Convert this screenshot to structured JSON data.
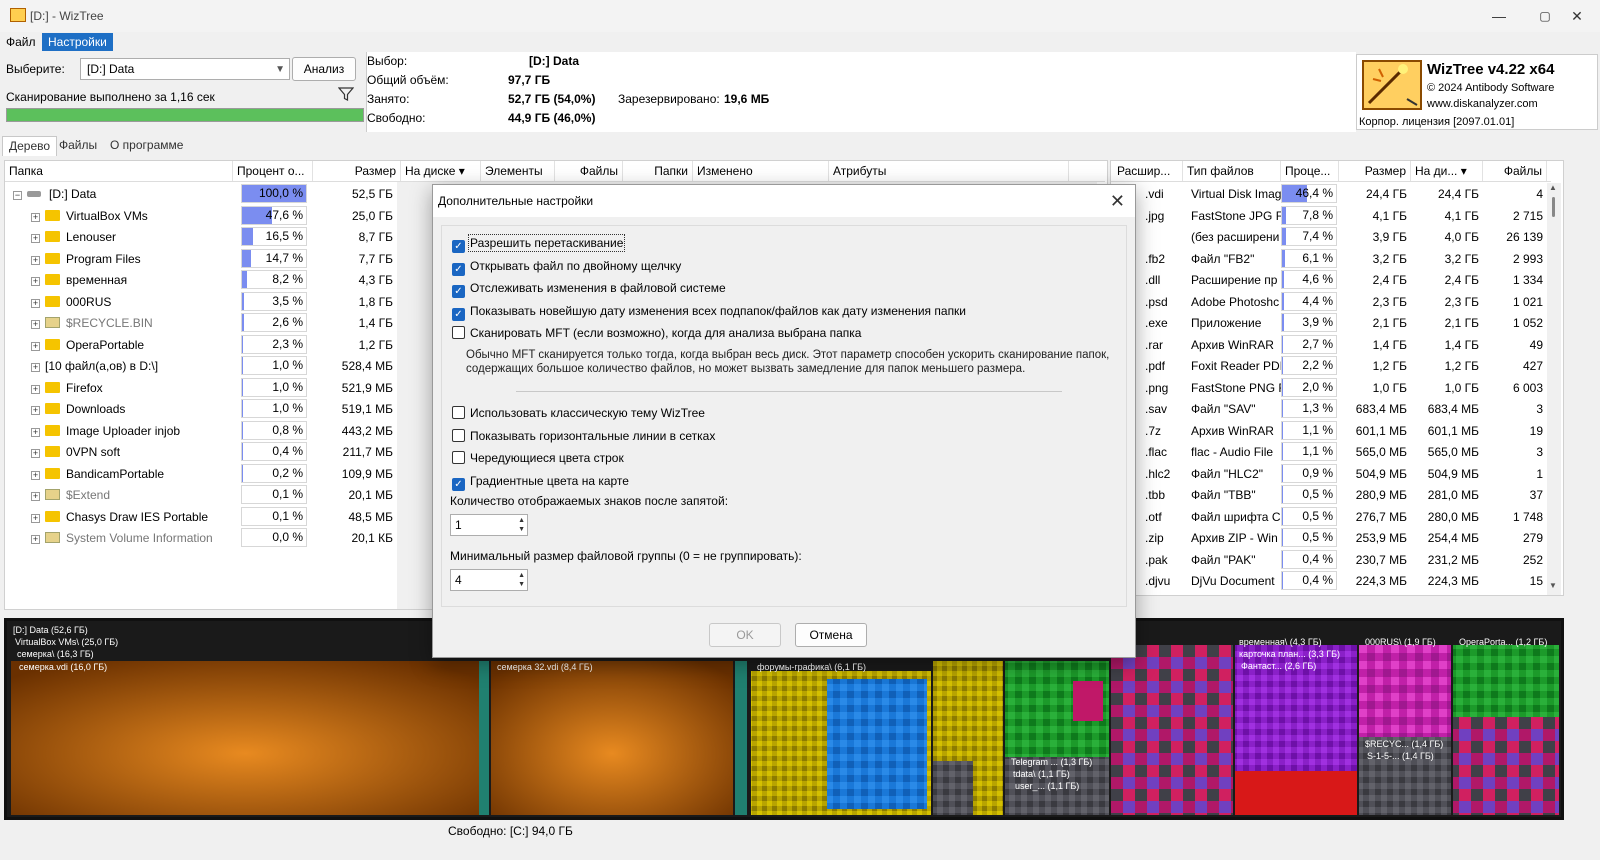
{
  "window": {
    "title": "[D:]  - WizTree",
    "min_label": "—",
    "max_label": "▢",
    "close_label": "✕"
  },
  "menu": {
    "items": [
      {
        "label": "Файл",
        "active": false
      },
      {
        "label": "Настройки",
        "active": true
      }
    ]
  },
  "top": {
    "select_label": "Выберите:",
    "drive": "[D:] Data",
    "analyze": "Анализ",
    "scan_status": "Сканирование выполнено за 1,16 сек",
    "scan_progress": 100,
    "stats": {
      "selection_label": "Выбор:",
      "selection_value": "[D:]  Data",
      "total_label": "Общий объём:",
      "total_value": "97,7 ГБ",
      "used_label": "Занято:",
      "used_value": "52,7 ГБ  (54,0%)",
      "free_label": "Свободно:",
      "free_value": "44,9 ГБ  (46,0%)",
      "reserved_label": "Зарезервировано:",
      "reserved_value": "19,6 МБ"
    },
    "logo": {
      "product": "WizTree v4.22 x64",
      "copyright": "© 2024 Antibody Software",
      "url": "www.diskanalyzer.com",
      "license": "Корпор. лицензия [2097.01.01]"
    }
  },
  "tabs": [
    {
      "label": "Дерево",
      "active": true
    },
    {
      "label": "Файлы",
      "active": false
    },
    {
      "label": "О программе",
      "active": false
    }
  ],
  "tree": {
    "headers": {
      "folder": "Папка",
      "percent": "Процент о...",
      "size": "Размер",
      "ondisk": "На диске ▾",
      "elements": "Элементы",
      "files": "Файлы",
      "folders": "Папки",
      "modified": "Изменено",
      "attrs": "Атрибуты"
    },
    "rows": [
      {
        "name": "[D:] Data",
        "pct": "100,0 %",
        "pct_value": 100,
        "size": "52,5 ГБ",
        "type": "drive",
        "expander": "−"
      },
      {
        "name": "VirtualBox VMs",
        "pct": "47,6 %",
        "pct_value": 47.6,
        "size": "25,0 ГБ",
        "type": "folder",
        "expander": "+"
      },
      {
        "name": "Lenouser",
        "pct": "16,5 %",
        "pct_value": 16.5,
        "size": "8,7 ГБ",
        "type": "folder",
        "expander": "+"
      },
      {
        "name": "Program Files",
        "pct": "14,7 %",
        "pct_value": 14.7,
        "size": "7,7 ГБ",
        "type": "folder",
        "expander": "+"
      },
      {
        "name": "временная",
        "pct": "8,2 %",
        "pct_value": 8.2,
        "size": "4,3 ГБ",
        "type": "folder",
        "expander": "+"
      },
      {
        "name": "000RUS",
        "pct": "3,5 %",
        "pct_value": 3.5,
        "size": "1,8 ГБ",
        "type": "folder",
        "expander": "+"
      },
      {
        "name": "$RECYCLE.BIN",
        "pct": "2,6 %",
        "pct_value": 2.6,
        "size": "1,4 ГБ",
        "type": "system",
        "expander": "+"
      },
      {
        "name": "OperaPortable",
        "pct": "2,3 %",
        "pct_value": 2.3,
        "size": "1,2 ГБ",
        "type": "folder",
        "expander": "+"
      },
      {
        "name": "[10 файл(а,ов) в D:\\]",
        "pct": "1,0 %",
        "pct_value": 1.0,
        "size": "528,4 МБ",
        "type": "files",
        "expander": "+"
      },
      {
        "name": "Firefox",
        "pct": "1,0 %",
        "pct_value": 1.0,
        "size": "521,9 МБ",
        "type": "folder",
        "expander": "+"
      },
      {
        "name": "Downloads",
        "pct": "1,0 %",
        "pct_value": 1.0,
        "size": "519,1 МБ",
        "type": "folder",
        "expander": "+"
      },
      {
        "name": "Image Uploader injob",
        "pct": "0,8 %",
        "pct_value": 0.8,
        "size": "443,2 МБ",
        "type": "folder",
        "expander": "+"
      },
      {
        "name": "0VPN soft",
        "pct": "0,4 %",
        "pct_value": 0.4,
        "size": "211,7 МБ",
        "type": "folder",
        "expander": "+"
      },
      {
        "name": "BandicamPortable",
        "pct": "0,2 %",
        "pct_value": 0.2,
        "size": "109,9 МБ",
        "type": "folder",
        "expander": "+"
      },
      {
        "name": "$Extend",
        "pct": "0,1 %",
        "pct_value": 0.1,
        "size": "20,1 МБ",
        "type": "system",
        "expander": "+"
      },
      {
        "name": "Chasys Draw IES Portable",
        "pct": "0,1 %",
        "pct_value": 0.1,
        "size": "48,5 МБ",
        "type": "folder",
        "expander": "+"
      },
      {
        "name": "System Volume Information",
        "pct": "0,0 %",
        "pct_value": 0.0,
        "size": "20,1 КБ",
        "type": "system",
        "expander": "+"
      }
    ]
  },
  "types": {
    "headers": {
      "ext": "Расшир...",
      "type": "Тип файлов",
      "pct": "Проце...",
      "size": "Размер",
      "ondisk": "На ди... ▾",
      "files": "Файлы"
    },
    "rows": [
      {
        "color": "#e07010",
        "ext": ".vdi",
        "type": "Virtual Disk Imag",
        "pct": "46,4 %",
        "pct_value": 46.4,
        "size": "24,4 ГБ",
        "ondisk": "24,4 ГБ",
        "files": "4"
      },
      {
        "color": "#d0c000",
        "ext": ".jpg",
        "type": "FastStone JPG Fi",
        "pct": "7,8 %",
        "pct_value": 7.8,
        "size": "4,1 ГБ",
        "ondisk": "4,1 ГБ",
        "files": "2 715"
      },
      {
        "color": "#404040",
        "ext": "",
        "type": "(без расширени",
        "pct": "7,4 %",
        "pct_value": 7.4,
        "size": "3,9 ГБ",
        "ondisk": "4,0 ГБ",
        "files": "26 139"
      },
      {
        "color": "#d01060",
        "ext": ".fb2",
        "type": "Файл \"FB2\"",
        "pct": "6,1 %",
        "pct_value": 6.1,
        "size": "3,2 ГБ",
        "ondisk": "3,2 ГБ",
        "files": "2 993"
      },
      {
        "color": "#9020c0",
        "ext": ".dll",
        "type": "Расширение пр",
        "pct": "4,6 %",
        "pct_value": 4.6,
        "size": "2,4 ГБ",
        "ondisk": "2,4 ГБ",
        "files": "1 334"
      },
      {
        "color": "#1060d0",
        "ext": ".psd",
        "type": "Adobe Photoshc",
        "pct": "4,4 %",
        "pct_value": 4.4,
        "size": "2,3 ГБ",
        "ondisk": "2,3 ГБ",
        "files": "1 021"
      },
      {
        "color": "#20a030",
        "ext": ".exe",
        "type": "Приложение",
        "pct": "3,9 %",
        "pct_value": 3.9,
        "size": "2,1 ГБ",
        "ondisk": "2,1 ГБ",
        "files": "1 052"
      },
      {
        "color": "#c02020",
        "ext": ".rar",
        "type": "Архив WinRAR",
        "pct": "2,7 %",
        "pct_value": 2.7,
        "size": "1,4 ГБ",
        "ondisk": "1,4 ГБ",
        "files": "49"
      },
      {
        "color": "#d02050",
        "ext": ".pdf",
        "type": "Foxit Reader PDF",
        "pct": "2,2 %",
        "pct_value": 2.2,
        "size": "1,2 ГБ",
        "ondisk": "1,2 ГБ",
        "files": "427"
      },
      {
        "color": "#2080a0",
        "ext": ".png",
        "type": "FastStone PNG F",
        "pct": "2,0 %",
        "pct_value": 2.0,
        "size": "1,0 ГБ",
        "ondisk": "1,0 ГБ",
        "files": "6 003"
      },
      {
        "color": "#6a6a6a",
        "ext": ".sav",
        "type": "Файл \"SAV\"",
        "pct": "1,3 %",
        "pct_value": 1.3,
        "size": "683,4 МБ",
        "ondisk": "683,4 МБ",
        "files": "3"
      },
      {
        "color": "#c020a0",
        "ext": ".7z",
        "type": "Архив WinRAR",
        "pct": "1,1 %",
        "pct_value": 1.1,
        "size": "601,1 МБ",
        "ondisk": "601,1 МБ",
        "files": "19"
      },
      {
        "color": "#40a0a0",
        "ext": ".flac",
        "type": "flac - Audio File",
        "pct": "1,1 %",
        "pct_value": 1.1,
        "size": "565,0 МБ",
        "ondisk": "565,0 МБ",
        "files": "3"
      },
      {
        "color": "#806040",
        "ext": ".hlc2",
        "type": "Файл \"HLC2\"",
        "pct": "0,9 %",
        "pct_value": 0.9,
        "size": "504,9 МБ",
        "ondisk": "504,9 МБ",
        "files": "1"
      },
      {
        "color": "#507090",
        "ext": ".tbb",
        "type": "Файл \"TBB\"",
        "pct": "0,5 %",
        "pct_value": 0.5,
        "size": "280,9 МБ",
        "ondisk": "281,0 МБ",
        "files": "37"
      },
      {
        "color": "#909030",
        "ext": ".otf",
        "type": "Файл шрифта C",
        "pct": "0,5 %",
        "pct_value": 0.5,
        "size": "276,7 МБ",
        "ondisk": "280,0 МБ",
        "files": "1 748"
      },
      {
        "color": "#a06030",
        "ext": ".zip",
        "type": "Архив ZIP - Win",
        "pct": "0,5 %",
        "pct_value": 0.5,
        "size": "253,9 МБ",
        "ondisk": "254,4 МБ",
        "files": "279"
      },
      {
        "color": "#3060a0",
        "ext": ".pak",
        "type": "Файл \"PAK\"",
        "pct": "0,4 %",
        "pct_value": 0.4,
        "size": "230,7 МБ",
        "ondisk": "231,2 МБ",
        "files": "252"
      },
      {
        "color": "#4040c0",
        "ext": ".djvu",
        "type": "DjVu Document",
        "pct": "0,4 %",
        "pct_value": 0.4,
        "size": "224,3 МБ",
        "ondisk": "224,3 МБ",
        "files": "15"
      }
    ]
  },
  "dialog": {
    "title": "Дополнительные настройки",
    "close": "✕",
    "options": [
      {
        "label": "Разрешить перетаскивание",
        "checked": true
      },
      {
        "label": "Открывать файл по двойному щелчку",
        "checked": true
      },
      {
        "label": "Отслеживать изменения в файловой системе",
        "checked": true
      },
      {
        "label": "Показывать новейшую дату изменения всех подпапок/файлов как дату изменения папки",
        "checked": true
      },
      {
        "label": "Сканировать MFT (если возможно), когда для анализа выбрана папка",
        "checked": false
      }
    ],
    "mft_note_1": "Обычно MFT сканируется только тогда, когда выбран весь диск. Этот параметр способен ускорить сканирование папок,",
    "mft_note_2": "содержащих большое количество файлов, но может вызвать замедление для папок меньшего размера.",
    "options2": [
      {
        "label": "Использовать классическую тему WizTree",
        "checked": false
      },
      {
        "label": "Показывать горизонтальные линии в сетках",
        "checked": false
      },
      {
        "label": "Чередующиеся цвета строк",
        "checked": false
      },
      {
        "label": "Градиентные цвета на карте",
        "checked": true
      }
    ],
    "decimals_label": "Количество отображаемых знаков после запятой:",
    "decimals_value": "1",
    "group_label": "Минимальный размер файловой группы (0 = не группировать):",
    "group_value": "4",
    "ok": "OK",
    "cancel": "Отмена"
  },
  "treemap": {
    "labels": {
      "root": "[D:] Data  (52,6 ГБ)",
      "vbox": "VirtualBox VMs\\ (25,0 ГБ)",
      "semerka": "семерка\\ (16,3 ГБ)",
      "semerka_vdi": "семерка.vdi (16,0 ГБ)",
      "semerka32": "семерка 32.vdi (8,4 ГБ)",
      "forums": "форумы-графика\\ (6,1 ГБ)",
      "vremennaya": "временная\\ (4,3 ГБ)",
      "kartochka": "карточка план... (3,3 ГБ)",
      "fantast": "Фантаст... (2,6 ГБ)",
      "rus": "000RUS\\ (1,9 ГБ)",
      "opera": "OperaPorta... (1,2 ГБ)",
      "telegram": "Telegram ... (1,3 ГБ)",
      "tdata": "tdata\\ (1,1 ГБ)",
      "user": "user_... (1,1 ГБ)",
      "recyc": "$RECYC... (1,4 ГБ)",
      "s15": "S-1-5-... (1,4 ГБ)"
    }
  },
  "status": {
    "text": "Свободно: [C:] 94,0 ГБ"
  },
  "colors": {
    "accent": "#1e6fc5",
    "progress": "#5cc05c",
    "pct_bar": "#7b8df0",
    "folder": "#f5c400"
  }
}
